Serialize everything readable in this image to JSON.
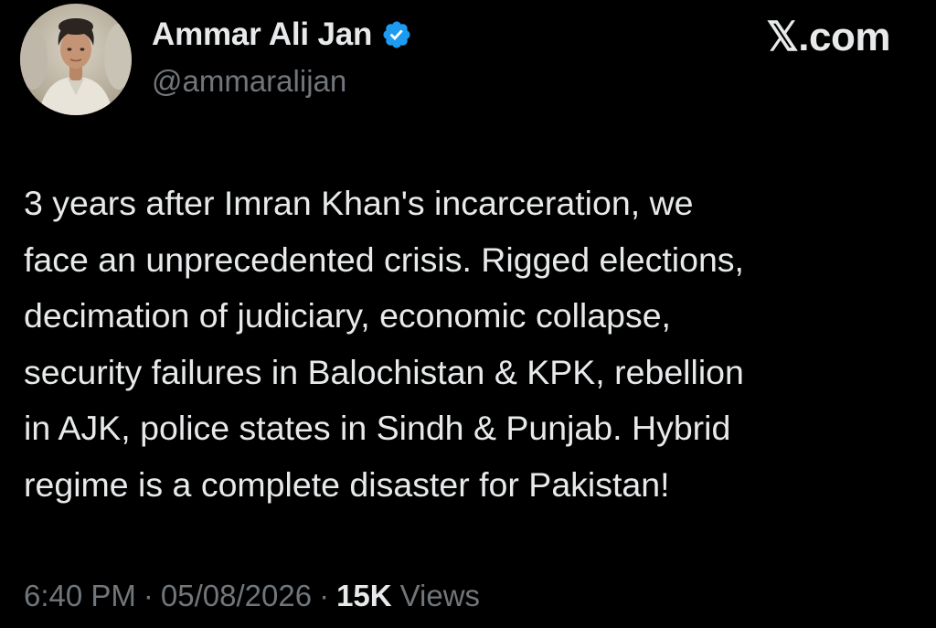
{
  "author": {
    "display_name": "Ammar Ali Jan",
    "handle": "@ammaralijan",
    "verified": true,
    "avatar_icon": "profile-photo-icon",
    "verified_icon": "verified-badge-icon"
  },
  "source": {
    "site": "𝕏.com"
  },
  "tweet": {
    "lines": [
      "3 years after Imran Khan's incarceration, we",
      "face an unprecedented crisis. Rigged elections,",
      "decimation of judiciary, economic collapse,",
      "security failures in Balochistan & KPK, rebellion",
      "in AJK, police states in Sindh & Punjab. Hybrid",
      "regime is a complete disaster for Pakistan!"
    ]
  },
  "meta": {
    "time": "6:40 PM",
    "separator": "·",
    "date": "05/08/2026",
    "views_count": "15K",
    "views_label": "Views"
  },
  "colors": {
    "background": "#000000",
    "primary_text": "#e7e9ea",
    "secondary_text": "#71767b",
    "verified_blue": "#1d9bf0"
  }
}
